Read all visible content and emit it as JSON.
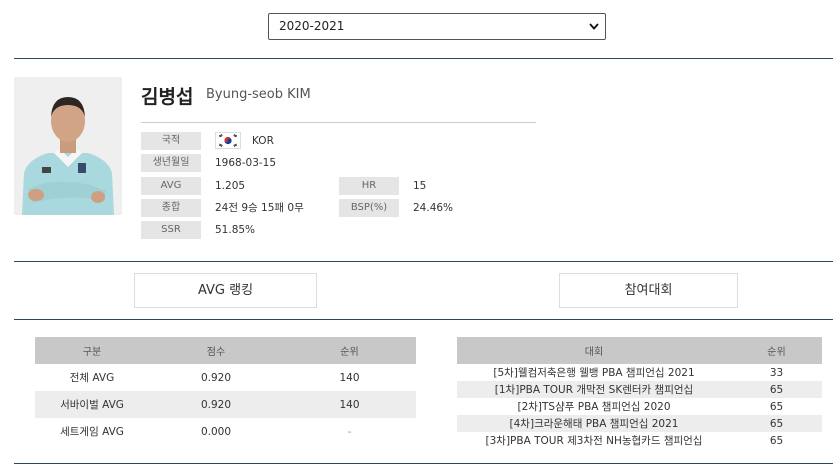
{
  "season": {
    "selected": "2020-2021"
  },
  "player": {
    "name_ko": "김병섭",
    "name_en": "Byung-seob KIM",
    "country_label": "국적",
    "country": "KOR",
    "birth_label": "생년월일",
    "birth": "1968-03-15",
    "avg_label": "AVG",
    "avg": "1.205",
    "hr_label": "HR",
    "hr": "15",
    "record_label": "종합",
    "record": "24전 9승 15패 0무",
    "bsp_label": "BSP(%)",
    "bsp": "24.46%",
    "ssr_label": "SSR",
    "ssr": "51.85%"
  },
  "tabs": {
    "avg_ranking": "AVG 랭킹",
    "tournaments": "참여대회"
  },
  "rank_table": {
    "headers": [
      "구분",
      "점수",
      "순위"
    ],
    "rows": [
      {
        "type": "전체 AVG",
        "score": "0.920",
        "rank": "140"
      },
      {
        "type": "서바이벌 AVG",
        "score": "0.920",
        "rank": "140"
      },
      {
        "type": "세트게임 AVG",
        "score": "0.000",
        "rank": "-"
      }
    ]
  },
  "tour_table": {
    "headers": [
      "대회",
      "순위"
    ],
    "rows": [
      {
        "name": "[5차]웰컴저축은행 웰뱅 PBA 챔피언십 2021",
        "rank": "33"
      },
      {
        "name": "[1차]PBA TOUR 개막전 SK렌터카 챔피언십",
        "rank": "65"
      },
      {
        "name": "[2차]TS샴푸 PBA 챔피언십 2020",
        "rank": "65"
      },
      {
        "name": "[4차]크라운해태 PBA 챔피언십 2021",
        "rank": "65"
      },
      {
        "name": "[3차]PBA TOUR 제3차전 NH농협카드 챔피언십",
        "rank": "65"
      }
    ]
  }
}
